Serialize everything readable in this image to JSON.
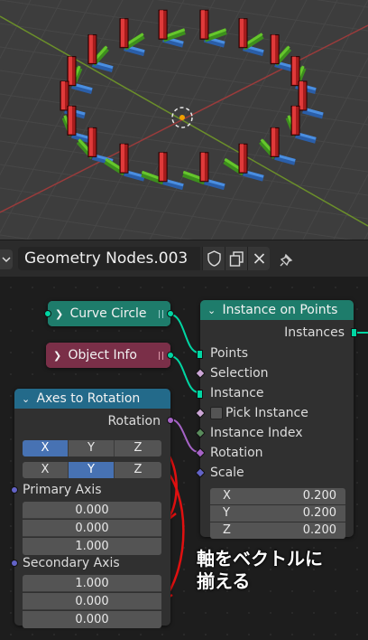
{
  "header": {
    "tree_name": "Geometry Nodes.003",
    "icons": [
      "dropdown-icon",
      "shield-icon",
      "duplicate-icon",
      "close-icon",
      "pin-icon"
    ]
  },
  "nodes": {
    "curve_circle": {
      "title": "Curve Circle",
      "color": "#1e7c6b"
    },
    "object_info": {
      "title": "Object Info",
      "color": "#7a2f48"
    },
    "instance_on_points": {
      "title": "Instance on Points",
      "color": "#1e7c6b",
      "output": "Instances",
      "inputs": [
        "Points",
        "Selection",
        "Instance",
        "Pick Instance",
        "Instance Index",
        "Rotation",
        "Scale"
      ],
      "scale": {
        "x_label": "X",
        "x": "0.200",
        "y_label": "Y",
        "y": "0.200",
        "z_label": "Z",
        "z": "0.200"
      }
    },
    "axes_to_rotation": {
      "title": "Axes to Rotation",
      "color": "#236a8a",
      "output": "Rotation",
      "axis_row1": {
        "options": [
          "X",
          "Y",
          "Z"
        ],
        "selected": "X"
      },
      "axis_row2": {
        "options": [
          "X",
          "Y",
          "Z"
        ],
        "selected": "Y"
      },
      "primary_label": "Primary Axis",
      "primary": [
        "0.000",
        "0.000",
        "1.000"
      ],
      "secondary_label": "Secondary Axis",
      "secondary": [
        "1.000",
        "0.000",
        "0.000"
      ]
    }
  },
  "annotation": {
    "line1": "軸をベクトルに",
    "line2": "揃える",
    "color": "#e01010"
  },
  "colors": {
    "geometry_socket": "#00d6a3",
    "vector_socket": "#6363c7",
    "rotation_socket": "#a663c7",
    "bool_socket": "#cca6d6",
    "int_socket": "#598c5c",
    "selected_option": "#4772b3"
  }
}
